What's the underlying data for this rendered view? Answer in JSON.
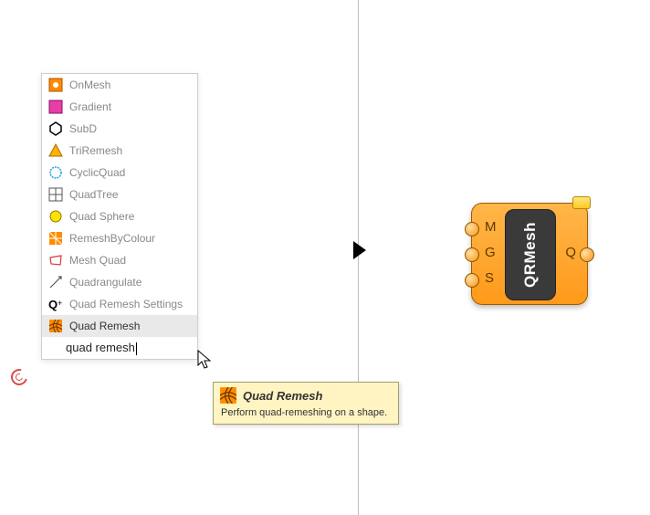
{
  "menu": {
    "items": [
      {
        "label": "OnMesh"
      },
      {
        "label": "Gradient"
      },
      {
        "label": "SubD"
      },
      {
        "label": "TriRemesh"
      },
      {
        "label": "CyclicQuad"
      },
      {
        "label": "QuadTree"
      },
      {
        "label": "Quad Sphere"
      },
      {
        "label": "RemeshByColour"
      },
      {
        "label": "Mesh Quad"
      },
      {
        "label": "Quadrangulate"
      },
      {
        "label": "Quad Remesh Settings"
      },
      {
        "label": "Quad Remesh"
      }
    ],
    "search_value": "quad remesh"
  },
  "tooltip": {
    "title": "Quad Remesh",
    "body": "Perform quad-remeshing on a shape."
  },
  "node": {
    "center_label": "QRMesh",
    "inputs": [
      "M",
      "G",
      "S"
    ],
    "outputs": [
      "Q"
    ]
  }
}
